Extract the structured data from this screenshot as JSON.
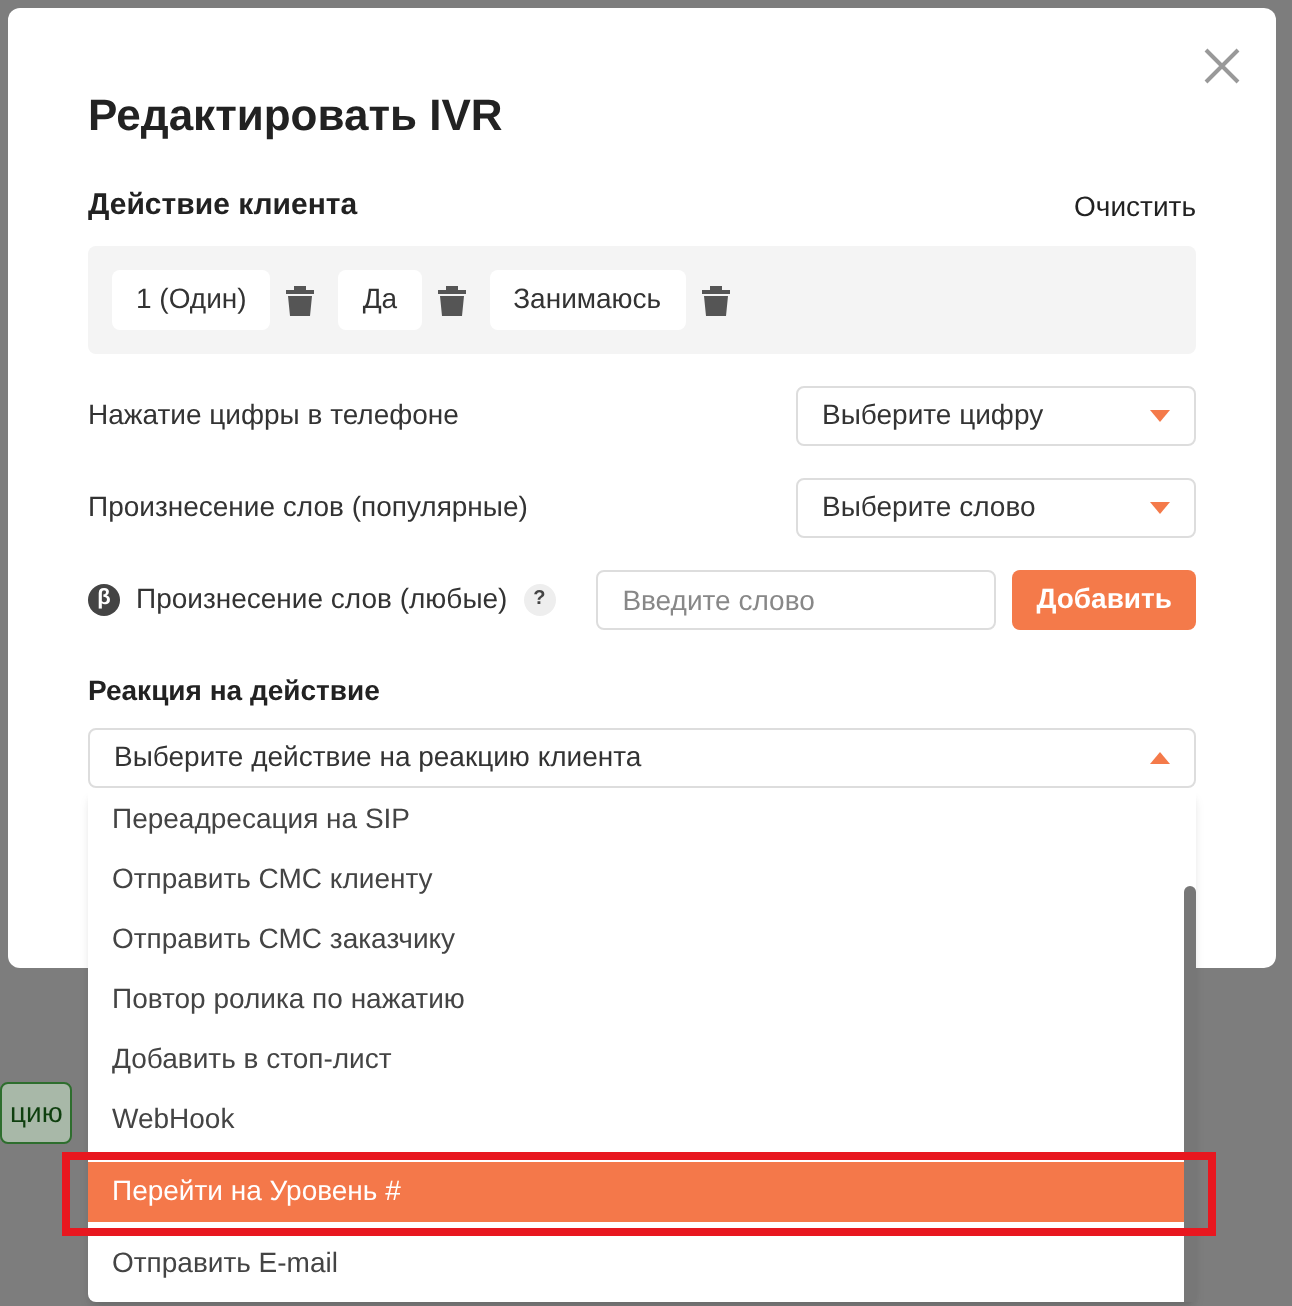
{
  "background": {
    "button_label": "цию"
  },
  "dialog": {
    "title": "Редактировать IVR",
    "client_action": {
      "heading": "Действие клиента",
      "clear": "Очистить",
      "chips": [
        {
          "label": "1 (Один)"
        },
        {
          "label": "Да"
        },
        {
          "label": "Занимаюсь"
        }
      ]
    },
    "digit": {
      "label": "Нажатие цифры в телефоне",
      "select": "Выберите цифру"
    },
    "popular": {
      "label": "Произнесение слов (популярные)",
      "select": "Выберите слово"
    },
    "any": {
      "badge": "β",
      "label": "Произнесение слов (любые)",
      "help": "?",
      "placeholder": "Введите слово",
      "button": "Добавить"
    },
    "reaction": {
      "heading": "Реакция на действие",
      "select": "Выберите действие на реакцию клиента",
      "expanded": true,
      "options": [
        {
          "label": "Переадресация на SIP",
          "selected": false
        },
        {
          "label": "Отправить СМС клиенту",
          "selected": false
        },
        {
          "label": "Отправить СМС заказчику",
          "selected": false
        },
        {
          "label": "Повтор ролика по нажатию",
          "selected": false
        },
        {
          "label": "Добавить в стоп-лист",
          "selected": false
        },
        {
          "label": "WebHook",
          "selected": false
        },
        {
          "label": "Перейти на Уровень #",
          "selected": true
        },
        {
          "label": "Отправить E-mail",
          "selected": false
        }
      ]
    }
  }
}
